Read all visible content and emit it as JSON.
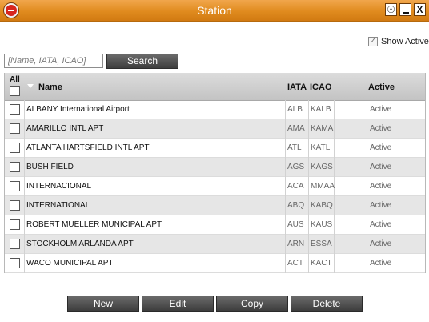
{
  "window": {
    "title": "Station",
    "restore_glyph": "☉",
    "close_glyph": "X"
  },
  "filters": {
    "show_active_label": "Show Active",
    "show_active_checked": true,
    "show_active_glyph": "✓"
  },
  "search": {
    "placeholder": "[Name, IATA, ICAO]",
    "value": "",
    "button_label": "Search"
  },
  "grid": {
    "headers": {
      "all": "All",
      "name": "Name",
      "iata": "IATA",
      "icao": "ICAO",
      "active": "Active"
    },
    "rows": [
      {
        "name": "ALBANY International Airport",
        "iata": "ALB",
        "icao": "KALB",
        "active": "Active"
      },
      {
        "name": "AMARILLO INTL APT",
        "iata": "AMA",
        "icao": "KAMA",
        "active": "Active"
      },
      {
        "name": "ATLANTA HARTSFIELD INTL APT",
        "iata": "ATL",
        "icao": "KATL",
        "active": "Active"
      },
      {
        "name": "BUSH FIELD",
        "iata": "AGS",
        "icao": "KAGS",
        "active": "Active"
      },
      {
        "name": "INTERNACIONAL",
        "iata": "ACA",
        "icao": "MMAA",
        "active": "Active"
      },
      {
        "name": "INTERNATIONAL",
        "iata": "ABQ",
        "icao": "KABQ",
        "active": "Active"
      },
      {
        "name": "ROBERT MUELLER MUNICIPAL APT",
        "iata": "AUS",
        "icao": "KAUS",
        "active": "Active"
      },
      {
        "name": "STOCKHOLM ARLANDA APT",
        "iata": "ARN",
        "icao": "ESSA",
        "active": "Active"
      },
      {
        "name": "WACO MUNICIPAL APT",
        "iata": "ACT",
        "icao": "KACT",
        "active": "Active"
      }
    ]
  },
  "actions": {
    "new": "New",
    "edit": "Edit",
    "copy": "Copy",
    "delete": "Delete"
  },
  "colors": {
    "titlebar": "#e08b1e",
    "button": "#4a4a4a",
    "header": "#cfcfcf",
    "row_alt": "#e6e6e6"
  }
}
